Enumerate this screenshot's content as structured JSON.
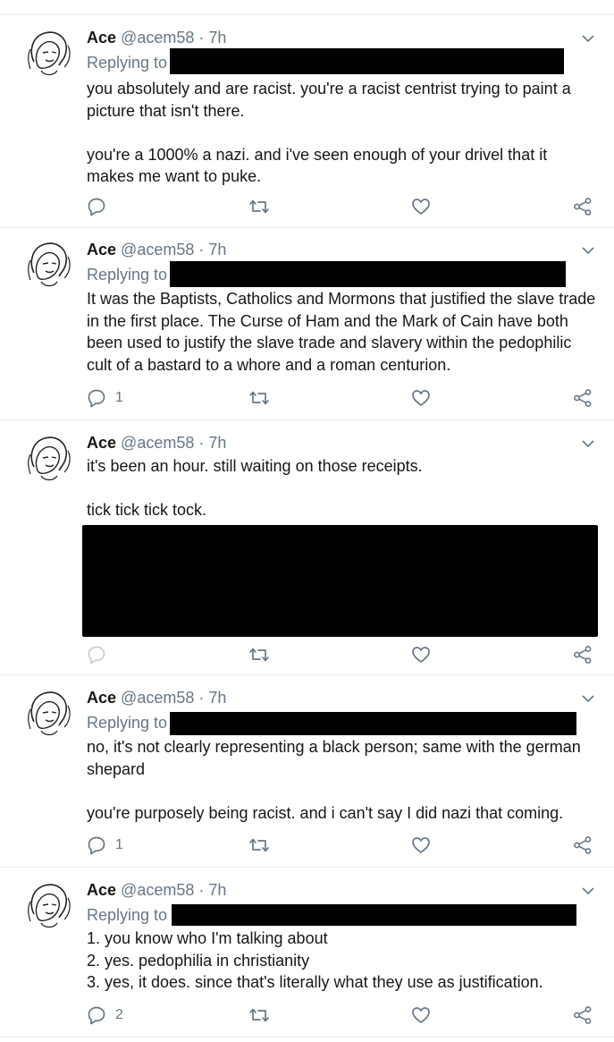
{
  "tweets": [
    {
      "name": "Ace",
      "handle": "@acem58",
      "separator": "·",
      "time": "7h",
      "replying_label": "Replying to",
      "paragraphs": [
        "you absolutely and are racist. you're a racist centrist trying to paint a picture that isn't there.",
        "you're a 1000% a nazi. and i've seen enough of your drivel that it makes me want to puke."
      ],
      "reply_count": "",
      "retweet_count": "",
      "like_count": ""
    },
    {
      "name": "Ace",
      "handle": "@acem58",
      "separator": "·",
      "time": "7h",
      "replying_label": "Replying to",
      "paragraphs": [
        "It was the Baptists, Catholics and Mormons that justified the slave trade in the first place. The Curse of Ham and the Mark of Cain have both been used to justify the slave trade and slavery within the pedophilic cult of a bastard to a whore and a roman centurion."
      ],
      "reply_count": "1",
      "retweet_count": "",
      "like_count": ""
    },
    {
      "name": "Ace",
      "handle": "@acem58",
      "separator": "·",
      "time": "7h",
      "replying_label": "",
      "paragraphs": [
        "it's been an hour. still waiting on those receipts.",
        "tick tick tick tock."
      ],
      "reply_count": "",
      "retweet_count": "",
      "like_count": ""
    },
    {
      "name": "Ace",
      "handle": "@acem58",
      "separator": "·",
      "time": "7h",
      "replying_label": "Replying to",
      "paragraphs": [
        "no, it's not clearly representing a black person; same with the german shepard",
        "you're purposely being racist. and i can't say I did nazi that coming."
      ],
      "reply_count": "1",
      "retweet_count": "",
      "like_count": ""
    },
    {
      "name": "Ace",
      "handle": "@acem58",
      "separator": "·",
      "time": "7h",
      "replying_label": "Replying to",
      "lines": [
        "1. you know who I'm talking about",
        "2. yes. pedophilia in christianity",
        "3. yes, it does. since that's literally what they use as justification."
      ],
      "reply_count": "2",
      "retweet_count": "",
      "like_count": ""
    }
  ],
  "icons": {
    "reply": "reply-icon",
    "retweet": "retweet-icon",
    "like": "like-icon",
    "share": "share-icon",
    "caret": "chevron-down-icon"
  },
  "colors": {
    "text": "#14171a",
    "muted": "#657786",
    "divider": "#e6ecf0",
    "redaction": "#000000"
  }
}
